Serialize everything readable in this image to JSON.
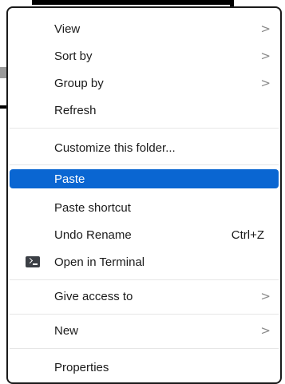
{
  "context_menu": {
    "items": [
      {
        "label": "View",
        "has_submenu": true
      },
      {
        "label": "Sort by",
        "has_submenu": true
      },
      {
        "label": "Group by",
        "has_submenu": true
      },
      {
        "label": "Refresh"
      },
      {
        "label": "Customize this folder..."
      },
      {
        "label": "Paste",
        "selected": true
      },
      {
        "label": "Paste shortcut"
      },
      {
        "label": "Undo Rename",
        "shortcut": "Ctrl+Z"
      },
      {
        "label": "Open in Terminal",
        "icon": "terminal-icon"
      },
      {
        "label": "Give access to",
        "has_submenu": true
      },
      {
        "label": "New",
        "has_submenu": true
      },
      {
        "label": "Properties"
      }
    ],
    "chevron_glyph": ">"
  },
  "colors": {
    "selection": "#0a66d2",
    "text": "#1b1b1b",
    "chevron": "#8a8a8a",
    "divider": "#e6e6e6"
  }
}
